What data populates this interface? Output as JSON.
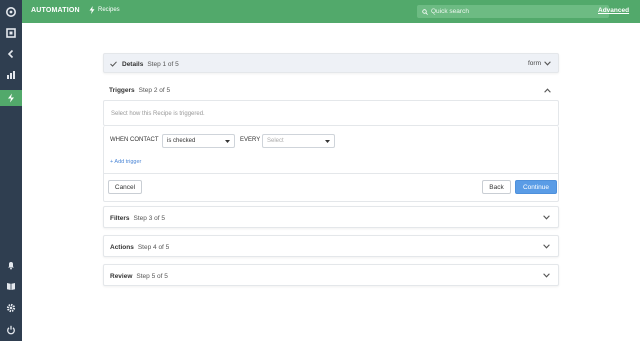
{
  "app": {
    "title": "AUTOMATION",
    "breadcrumb": "Recipes",
    "search_placeholder": "Quick search",
    "advanced_link": "Advanced",
    "accent_color": "#52a96b",
    "rail_color": "#2f3e50"
  },
  "rail_icons": [
    "logo-icon",
    "square-icon",
    "back-arrow-icon",
    "bar-chart-icon",
    "lightning-icon",
    "bell-icon",
    "book-icon",
    "gear-icon",
    "power-icon"
  ],
  "steps": {
    "details": {
      "title": "Details",
      "step": "Step 1 of 5",
      "value": "form"
    },
    "triggers": {
      "title": "Triggers",
      "step": "Step 2 of 5",
      "hint": "Select how this Recipe is triggered.",
      "condition_label": "WHEN CONTACT",
      "condition_value": "is checked",
      "every_label": "EVERY",
      "every_placeholder": "Select",
      "add_trigger": "+ Add trigger",
      "cancel": "Cancel",
      "back": "Back",
      "continue": "Continue"
    },
    "filters": {
      "title": "Filters",
      "step": "Step 3 of 5"
    },
    "actions": {
      "title": "Actions",
      "step": "Step 4 of 5"
    },
    "review": {
      "title": "Review",
      "step": "Step 5 of 5"
    }
  }
}
